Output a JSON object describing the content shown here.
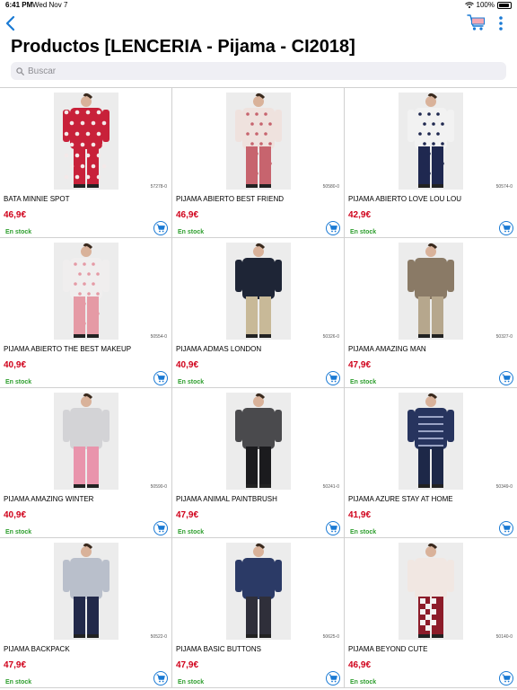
{
  "status_bar": {
    "time": "6:41 PM",
    "date": "Wed Nov 7",
    "battery": "100%"
  },
  "header": {
    "title": "Productos [LENCERIA - Pijama - CI2018]",
    "back_icon": "chevron-left-icon",
    "cart_icon": "shopping-cart-icon",
    "more_icon": "more-vertical-icon"
  },
  "search": {
    "placeholder": "Buscar",
    "value": ""
  },
  "colors": {
    "accent": "#1a7ad4",
    "price": "#d0021b",
    "stock": "#2e9e2e"
  },
  "products": [
    {
      "name": "BATA MINNIE SPOT",
      "ref": "57278-0",
      "price": "46,9€",
      "stock": "En stock",
      "main": "#c8213a",
      "alt": "#f4e9e9",
      "pattern": "hearts"
    },
    {
      "name": "PIJAMA ABIERTO BEST FRIEND",
      "ref": "50580-0",
      "price": "46,9€",
      "stock": "En stock",
      "main": "#efe2de",
      "alt": "#c7646e",
      "pattern": "floral"
    },
    {
      "name": "PIJAMA ABIERTO LOVE LOU LOU",
      "ref": "50574-0",
      "price": "42,9€",
      "stock": "En stock",
      "main": "#f2f2f2",
      "alt": "#1f2850",
      "pattern": "print"
    },
    {
      "name": "PIJAMA ABIERTO THE BEST MAKEUP",
      "ref": "50554-0",
      "price": "40,9€",
      "stock": "En stock",
      "main": "#f0eeee",
      "alt": "#e59aa5",
      "pattern": "print"
    },
    {
      "name": "PIJAMA ADMAS LONDON",
      "ref": "50326-0",
      "price": "40,9€",
      "stock": "En stock",
      "main": "#1e2536",
      "alt": "#c8b998",
      "pattern": "top"
    },
    {
      "name": "PIJAMA AMAZING MAN",
      "ref": "50327-0",
      "price": "47,9€",
      "stock": "En stock",
      "main": "#8a7a66",
      "alt": "#b6a78d",
      "pattern": "top"
    },
    {
      "name": "PIJAMA AMAZING WINTER",
      "ref": "50590-0",
      "price": "40,9€",
      "stock": "En stock",
      "main": "#d3d3d6",
      "alt": "#e994ac",
      "pattern": "top"
    },
    {
      "name": "PIJAMA ANIMAL PAINTBRUSH",
      "ref": "50241-0",
      "price": "47,9€",
      "stock": "En stock",
      "main": "#4a4a4d",
      "alt": "#1b1b1e",
      "pattern": "top"
    },
    {
      "name": "PIJAMA AZURE STAY AT HOME",
      "ref": "50349-0",
      "price": "41,9€",
      "stock": "En stock",
      "main": "#27345e",
      "alt": "#1d2848",
      "pattern": "stripes"
    },
    {
      "name": "PIJAMA BACKPACK",
      "ref": "50522-0",
      "price": "47,9€",
      "stock": "En stock",
      "main": "#b9bfcb",
      "alt": "#22294a",
      "pattern": "top"
    },
    {
      "name": "PIJAMA BASIC BUTTONS",
      "ref": "50625-0",
      "price": "47,9€",
      "stock": "En stock",
      "main": "#2b3a66",
      "alt": "#2f2f3a",
      "pattern": "top"
    },
    {
      "name": "PIJAMA BEYOND CUTE",
      "ref": "50140-0",
      "price": "46,9€",
      "stock": "En stock",
      "main": "#f1e7e2",
      "alt": "#8c1c2a",
      "pattern": "check"
    }
  ]
}
